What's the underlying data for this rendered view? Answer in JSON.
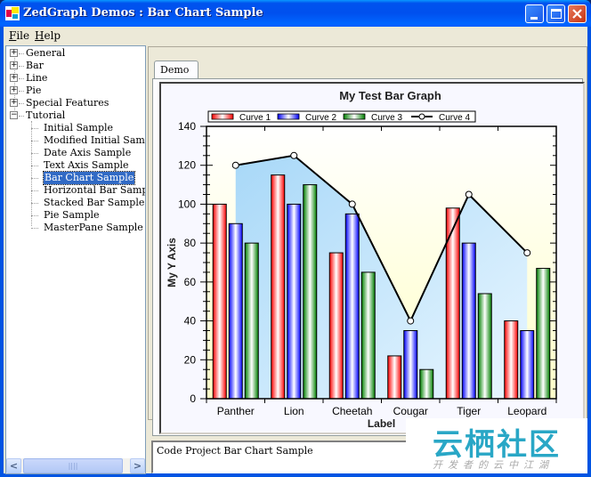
{
  "window": {
    "title": "ZedGraph Demos : Bar Chart Sample",
    "buttons": [
      "minimize",
      "maximize",
      "close"
    ]
  },
  "menu": [
    {
      "label": "File",
      "accel": "F",
      "rest": "ile"
    },
    {
      "label": "Help",
      "accel": "H",
      "rest": "elp"
    }
  ],
  "tree": {
    "roots": [
      {
        "label": "General",
        "expander": "+"
      },
      {
        "label": "Bar",
        "expander": "+"
      },
      {
        "label": "Line",
        "expander": "+"
      },
      {
        "label": "Pie",
        "expander": "+"
      },
      {
        "label": "Special Features",
        "expander": "+"
      },
      {
        "label": "Tutorial",
        "expander": "−"
      }
    ],
    "children": [
      {
        "label": "Initial Sample"
      },
      {
        "label": "Modified Initial Sample"
      },
      {
        "label": "Date Axis Sample"
      },
      {
        "label": "Text Axis Sample"
      },
      {
        "label": "Bar Chart Sample",
        "selected": true
      },
      {
        "label": "Horizontal Bar Sample"
      },
      {
        "label": "Stacked Bar Sample"
      },
      {
        "label": "Pie Sample"
      },
      {
        "label": "MasterPane Sample"
      }
    ],
    "scroll": {
      "left": "<",
      "right": ">",
      "thumb": "||||"
    }
  },
  "tabs": [
    {
      "label": "Demo",
      "active": true
    }
  ],
  "status_text": "Code Project Bar Chart Sample",
  "watermark": {
    "big": "云栖社区",
    "small": "开发者的云中江湖"
  },
  "chart_data": {
    "type": "bar",
    "title": "My Test Bar Graph",
    "xlabel": "Label",
    "ylabel": "My Y Axis",
    "categories": [
      "Panther",
      "Lion",
      "Cheetah",
      "Cougar",
      "Tiger",
      "Leopard"
    ],
    "ylim": [
      0,
      140
    ],
    "yticks": [
      0,
      20,
      40,
      60,
      80,
      100,
      120,
      140
    ],
    "legend_position": "top",
    "series": [
      {
        "name": "Curve 1",
        "kind": "bar",
        "color": "#ff0000",
        "values": [
          100,
          115,
          75,
          22,
          98,
          40
        ]
      },
      {
        "name": "Curve 2",
        "kind": "bar",
        "color": "#0000ff",
        "values": [
          90,
          100,
          95,
          35,
          80,
          35
        ]
      },
      {
        "name": "Curve 3",
        "kind": "bar",
        "color": "#008000",
        "values": [
          80,
          110,
          65,
          15,
          54,
          67
        ]
      },
      {
        "name": "Curve 4",
        "kind": "line-fill",
        "color": "#000000",
        "fill": "#a8d8f8",
        "values": [
          120,
          125,
          100,
          40,
          105,
          75
        ]
      }
    ],
    "background": {
      "chart_fill_top": "#ffffff",
      "chart_fill_bottom": "#ffffc8",
      "pane": "#f8f8ff"
    }
  }
}
